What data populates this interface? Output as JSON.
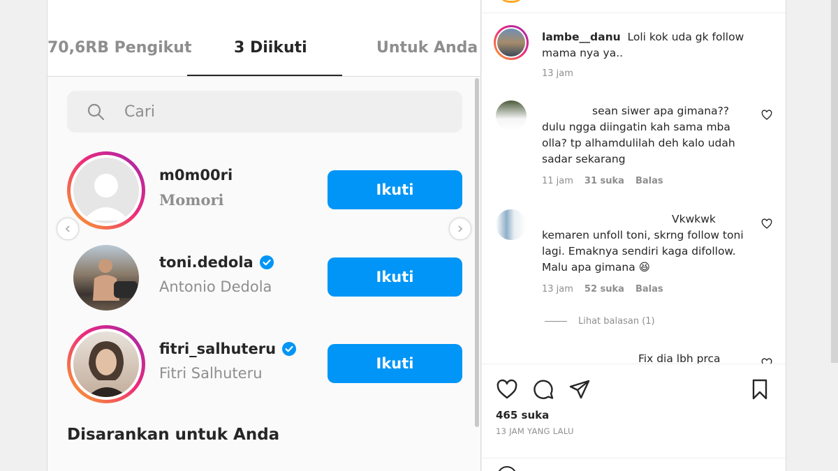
{
  "tabs": {
    "followers": "70,6RB Pengikut",
    "following": "3 Diikuti",
    "for_you": "Untuk Anda"
  },
  "search": {
    "placeholder": "Cari"
  },
  "users": [
    {
      "username": "m0m00ri",
      "full_name": "Momori",
      "verified": false,
      "button": "Ikuti"
    },
    {
      "username": "toni.dedola",
      "full_name": "Antonio Dedola",
      "verified": true,
      "button": "Ikuti"
    },
    {
      "username": "fitri_salhuteru",
      "full_name": "Fitri Salhuteru",
      "verified": true,
      "button": "Ikuti"
    }
  ],
  "suggested_title": "Disarankan untuk Anda",
  "comments": [
    {
      "username": "lambe__danu",
      "text": "Loli kok uda gk follow mama nya ya..",
      "time": "13 jam",
      "likes": "",
      "reply": ""
    },
    {
      "username": "",
      "text": "sean siwer apa gimana?? dulu ngga diingatin kah sama mba olla? tp alhamdulilah deh kalo udah sadar sekarang",
      "time": "11 jam",
      "likes": "31 suka",
      "reply": "Balas"
    },
    {
      "username": "",
      "text": "Vkwkwk kemaren unfoll toni, skrng follow toni lagi. Emaknya sendiri kaga difollow. Malu apa gimana 😆",
      "time": "13 jam",
      "likes": "52 suka",
      "reply": "Balas"
    },
    {
      "username": "",
      "text": "Fix dia lbh prca",
      "time": "",
      "likes": "",
      "reply": ""
    }
  ],
  "view_replies": "Lihat balasan (1)",
  "post": {
    "likes": "465 suka",
    "time_ago": "13 JAM YANG LALU"
  },
  "colors": {
    "primary_button": "#0095f6",
    "text": "#262626",
    "secondary_text": "#8e8e8e"
  }
}
